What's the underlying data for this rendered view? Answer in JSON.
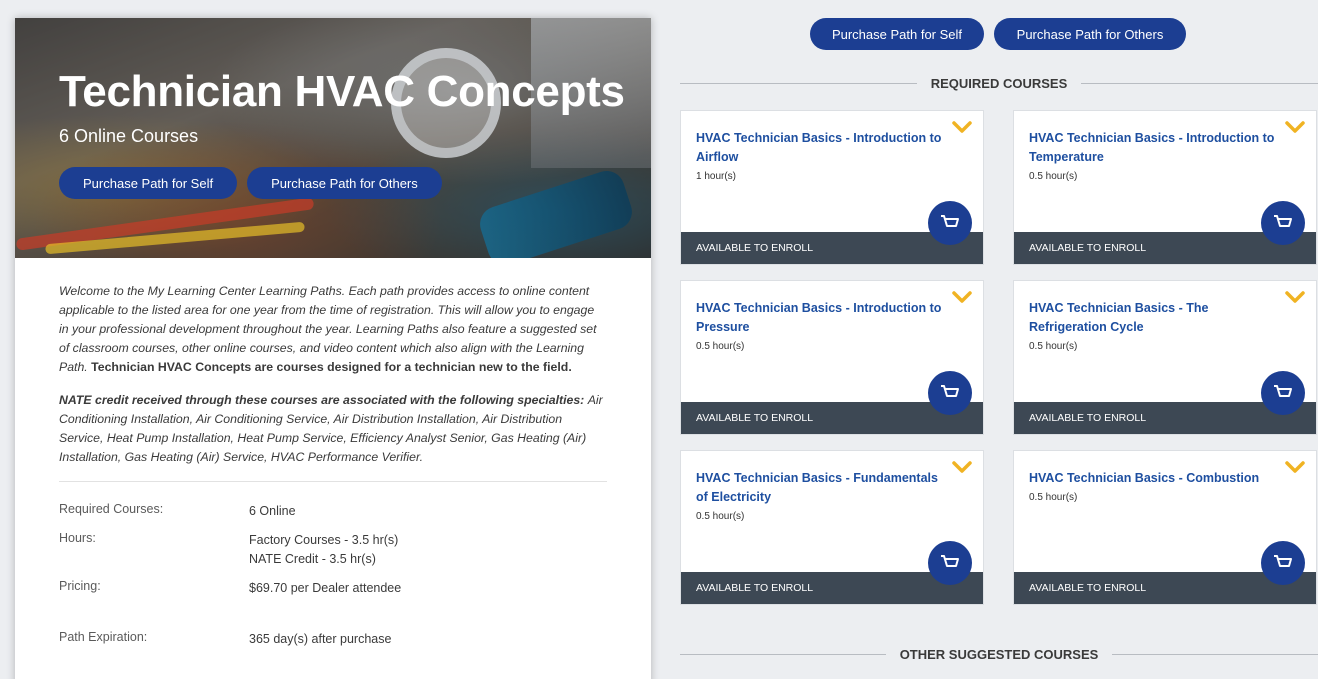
{
  "path": {
    "title": "Technician HVAC Concepts",
    "subtitle": "6 Online Courses",
    "purchase_self_label": "Purchase Path for Self",
    "purchase_others_label": "Purchase Path for Others"
  },
  "description": {
    "intro": "Welcome to the My Learning Center Learning Paths. Each path provides access to online content applicable to the listed area for one year from the time of registration. This will allow you to engage in your professional development throughout the year. Learning Paths also feature a suggested set of classroom courses, other online courses, and video content which also align with the Learning Path.",
    "intro_bold": "Technician HVAC Concepts are courses designed for a technician new to the field.",
    "nate_bold": "NATE credit received through these courses are associated with the following specialties:",
    "nate_list": "Air Conditioning Installation, Air Conditioning Service, Air Distribution Installation, Air Distribution Service, Heat Pump Installation, Heat Pump Service, Efficiency Analyst Senior, Gas Heating (Air) Installation, Gas Heating (Air) Service,  HVAC Performance Verifier."
  },
  "info": {
    "required_label": "Required Courses:",
    "required_value": "6 Online",
    "hours_label": "Hours:",
    "hours_factory": "Factory Courses - 3.5 hr(s)",
    "hours_nate": "NATE Credit - 3.5 hr(s)",
    "pricing_label": "Pricing:",
    "pricing_value": "$69.70 per Dealer attendee",
    "expiration_label": "Path Expiration:",
    "expiration_value": "365 day(s) after purchase"
  },
  "right": {
    "purchase_self_label": "Purchase Path for Self",
    "purchase_others_label": "Purchase Path for Others",
    "required_heading": "REQUIRED COURSES",
    "other_heading": "OTHER SUGGESTED COURSES"
  },
  "courses": [
    {
      "title": "HVAC Technician Basics - Introduction to Airflow",
      "hours": "1 hour(s)",
      "status": "AVAILABLE TO ENROLL"
    },
    {
      "title": "HVAC Technician Basics - Introduction to Temperature",
      "hours": "0.5 hour(s)",
      "status": "AVAILABLE TO ENROLL"
    },
    {
      "title": "HVAC Technician Basics - Introduction to Pressure",
      "hours": "0.5 hour(s)",
      "status": "AVAILABLE TO ENROLL"
    },
    {
      "title": "HVAC Technician Basics - The Refrigeration Cycle",
      "hours": "0.5 hour(s)",
      "status": "AVAILABLE TO ENROLL"
    },
    {
      "title": "HVAC Technician Basics - Fundamentals of Electricity",
      "hours": "0.5 hour(s)",
      "status": "AVAILABLE TO ENROLL"
    },
    {
      "title": "HVAC Technician Basics - Combustion",
      "hours": "0.5 hour(s)",
      "status": "AVAILABLE TO ENROLL"
    }
  ],
  "colors": {
    "accent_blue": "#1c3e92",
    "chevron_gold": "#f0b323",
    "footer_slate": "#3d4854",
    "link_blue": "#1e4fa0"
  },
  "icons": {
    "cart": "shopping-cart-icon",
    "chevron": "chevron-down-icon"
  }
}
